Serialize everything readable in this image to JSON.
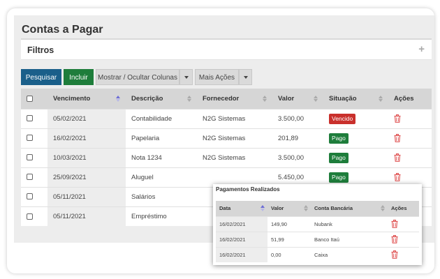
{
  "page": {
    "title": "Contas a Pagar"
  },
  "filters": {
    "label": "Filtros"
  },
  "toolbar": {
    "search_label": "Pesquisar",
    "add_label": "Incluir",
    "columns_label": "Mostrar / Ocultar Colunas",
    "actions_label": "Mais Ações"
  },
  "table": {
    "headers": [
      "Vencimento",
      "Descrição",
      "Fornecedor",
      "Valor",
      "Situação",
      "Ações"
    ],
    "rows": [
      {
        "due": "05/02/2021",
        "desc": "Contabilidade",
        "supplier": "N2G Sistemas",
        "value": "3.500,00",
        "status": "Vencido",
        "status_kind": "overdue"
      },
      {
        "due": "16/02/2021",
        "desc": "Papelaria",
        "supplier": "N2G Sistemas",
        "value": "201,89",
        "status": "Pago",
        "status_kind": "paid"
      },
      {
        "due": "10/03/2021",
        "desc": "Nota 1234",
        "supplier": "N2G Sistemas",
        "value": "3.500,00",
        "status": "Pago",
        "status_kind": "paid"
      },
      {
        "due": "25/09/2021",
        "desc": "Aluguel",
        "supplier": "",
        "value": "5.450,00",
        "status": "Pago",
        "status_kind": "paid"
      },
      {
        "due": "05/11/2021",
        "desc": "Salários",
        "supplier": "",
        "value": "",
        "status": "",
        "status_kind": ""
      },
      {
        "due": "05/11/2021",
        "desc": "Empréstimo",
        "supplier": "",
        "value": "",
        "status": "",
        "status_kind": ""
      }
    ]
  },
  "payments": {
    "title": "Pagamentos Realizados",
    "headers": [
      "Data",
      "Valor",
      "Conta Bancária",
      "Ações"
    ],
    "rows": [
      {
        "date": "16/02/2021",
        "value": "149,90",
        "account": "Nubank"
      },
      {
        "date": "16/02/2021",
        "value": "51,99",
        "account": "Banco Itaú"
      },
      {
        "date": "16/02/2021",
        "value": "0,00",
        "account": "Caixa"
      }
    ]
  },
  "colors": {
    "primary": "#1a5f8a",
    "success": "#1e7d3b",
    "danger": "#c9302c",
    "trash": "#e05555"
  },
  "icons": {
    "trash": "trash-icon",
    "plus": "plus-icon",
    "sort": "sort-icon",
    "caret": "caret-down-icon"
  }
}
